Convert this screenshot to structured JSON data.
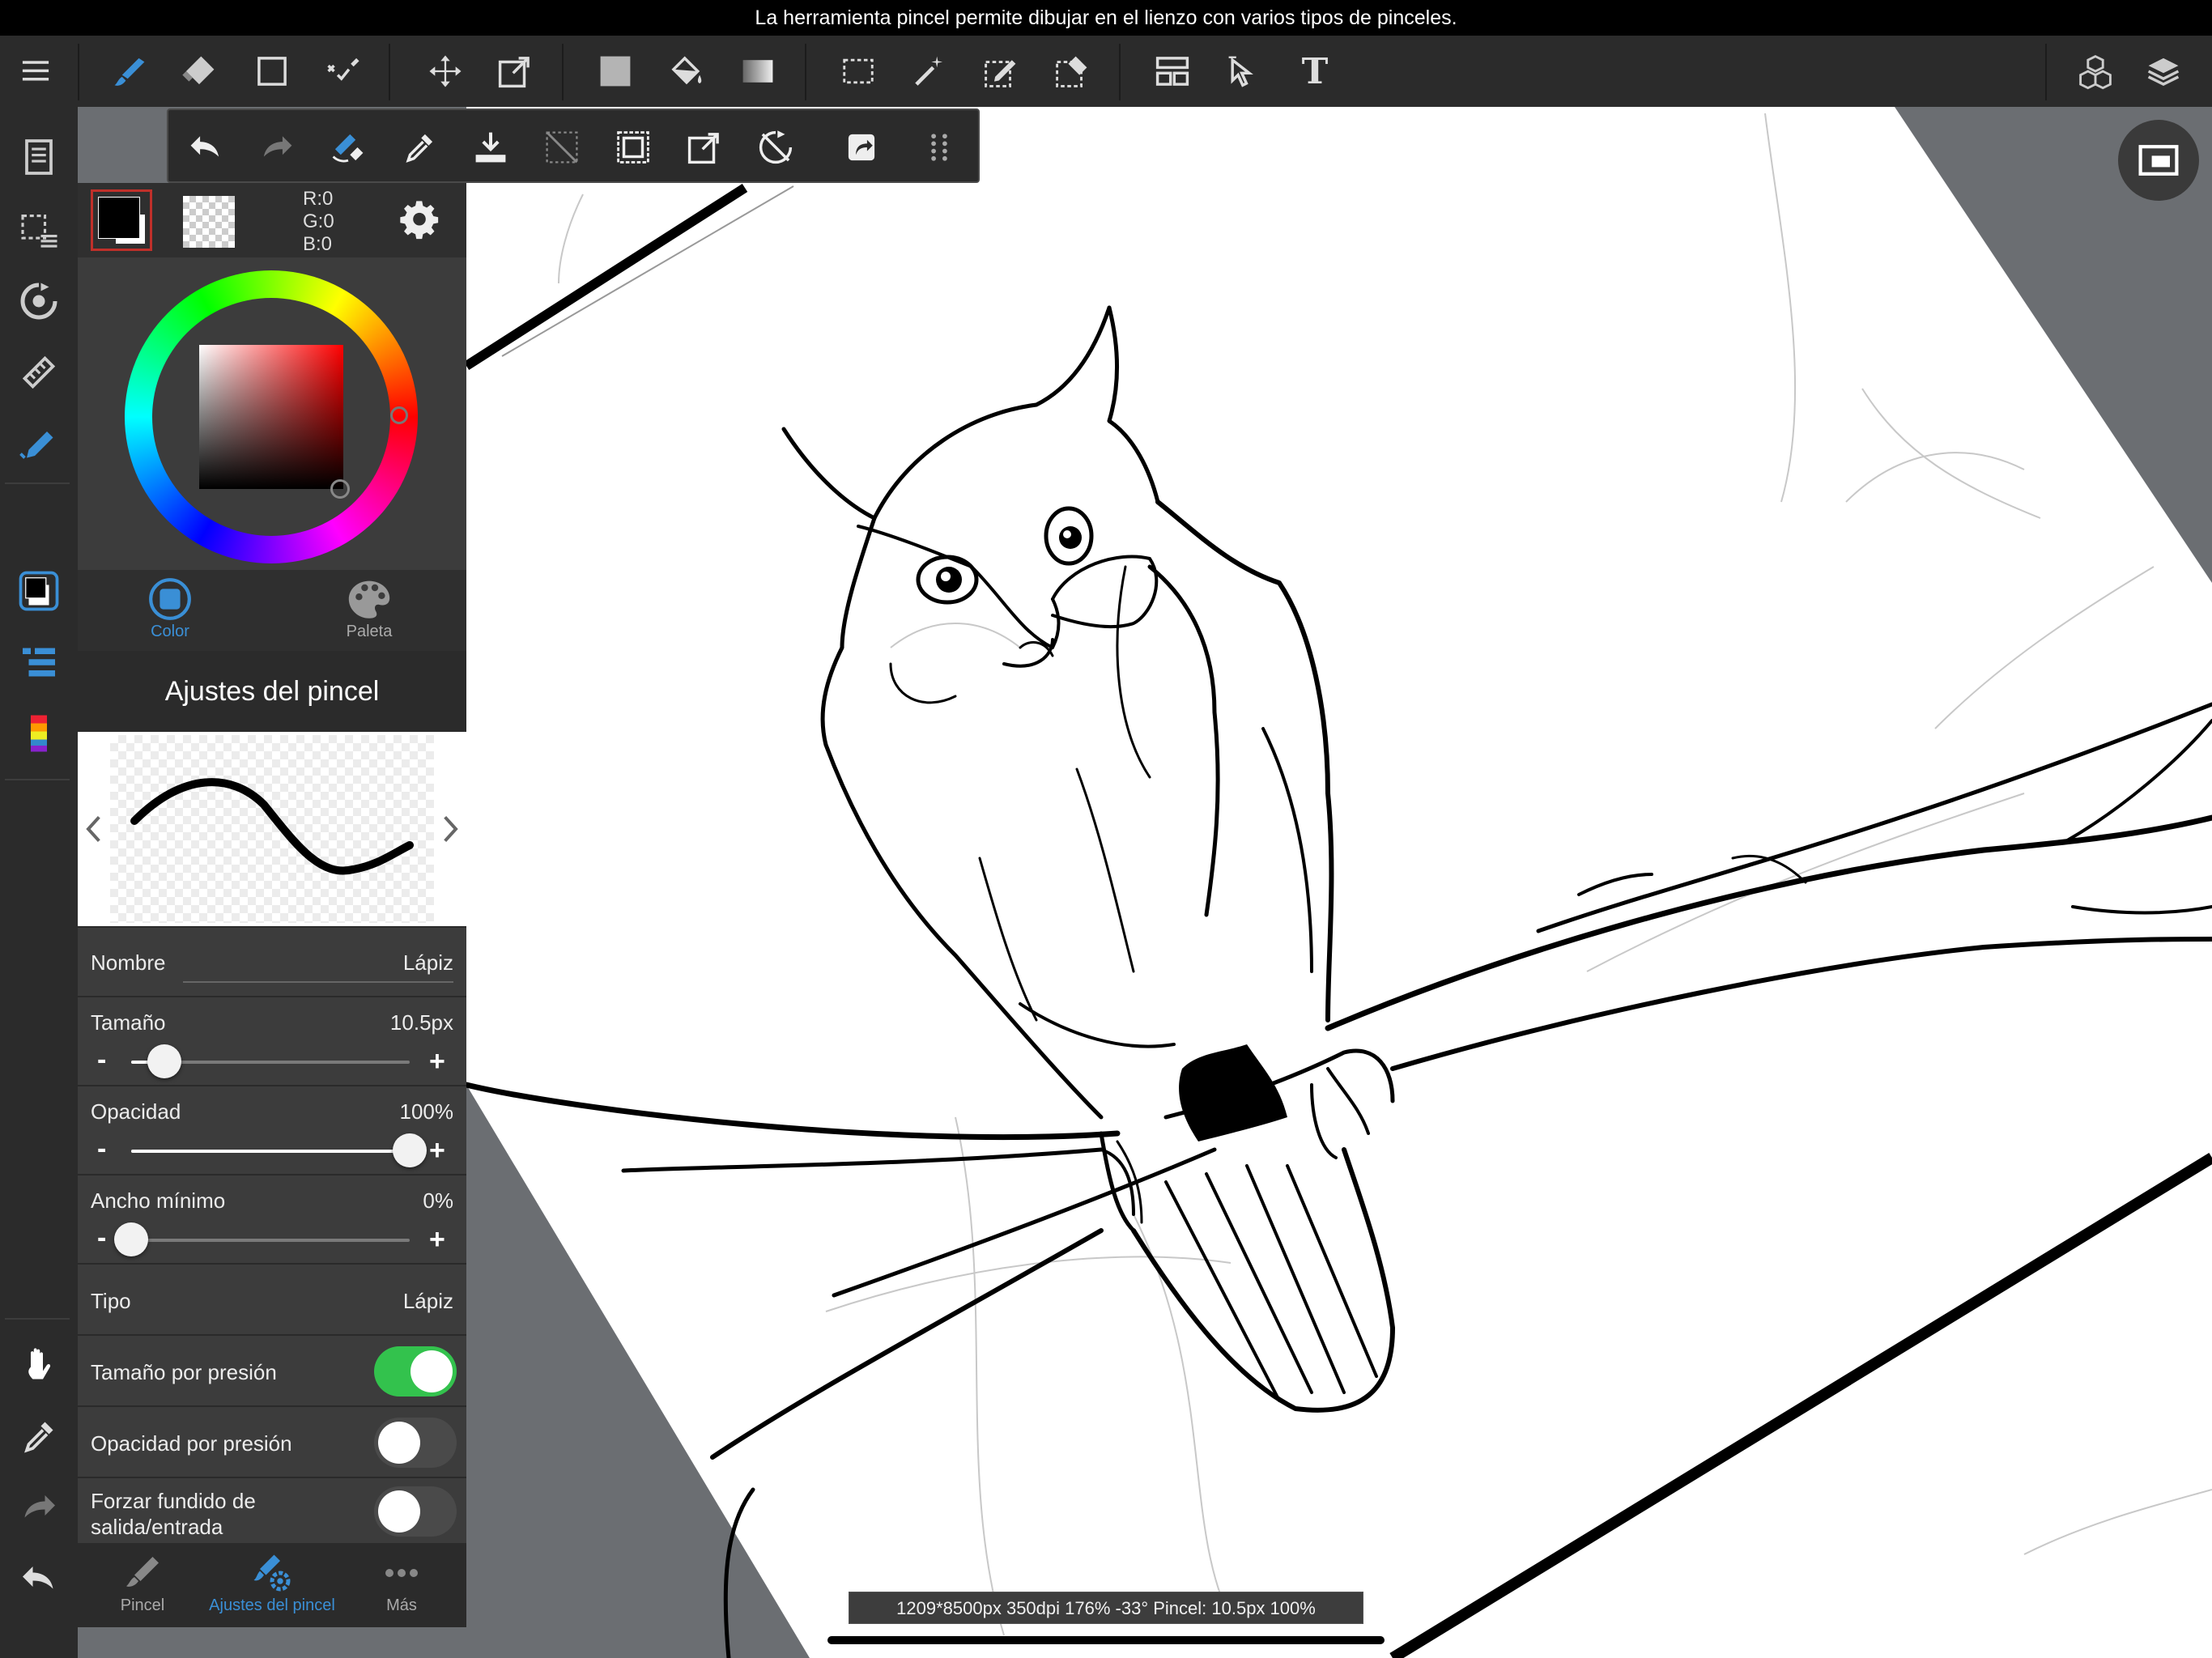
{
  "status_bar": {
    "message": "La herramienta pincel permite dibujar en el lienzo con varios tipos de pinceles."
  },
  "toolbar": {
    "tools": [
      {
        "name": "menu-icon"
      },
      {
        "name": "brush-icon"
      },
      {
        "name": "eraser-icon"
      },
      {
        "name": "shape-icon"
      },
      {
        "name": "stroke-correction-icon"
      },
      {
        "name": "move-icon"
      },
      {
        "name": "transform-icon"
      },
      {
        "name": "fill-color-icon"
      },
      {
        "name": "bucket-icon"
      },
      {
        "name": "gradient-icon"
      },
      {
        "name": "select-icon"
      },
      {
        "name": "magic-wand-icon"
      },
      {
        "name": "select-pen-icon"
      },
      {
        "name": "select-eraser-icon"
      },
      {
        "name": "frame-divider-icon"
      },
      {
        "name": "operation-icon"
      },
      {
        "name": "text-icon"
      },
      {
        "name": "material-icon"
      },
      {
        "name": "layers-icon"
      }
    ],
    "text_tool_label": "T",
    "accent_color": "#3a8fd6"
  },
  "color_panel": {
    "rgb": {
      "r": "R:0",
      "g": "G:0",
      "b": "B:0"
    },
    "tabs": [
      {
        "label": "Color"
      },
      {
        "label": "Paleta"
      }
    ],
    "foreground": "#000000"
  },
  "brush_settings": {
    "title": "Ajustes del pincel",
    "name_label": "Nombre",
    "name_value": "Lápiz",
    "size_label": "Tamaño",
    "size_value": "10.5px",
    "size_fraction": 0.12,
    "opacity_label": "Opacidad",
    "opacity_value": "100%",
    "opacity_fraction": 1.0,
    "min_width_label": "Ancho mínimo",
    "min_width_value": "0%",
    "min_width_fraction": 0.0,
    "type_label": "Tipo",
    "type_value": "Lápiz",
    "pressure_size_label": "Tamaño por presión",
    "pressure_size_on": true,
    "pressure_opacity_label": "Opacidad por presión",
    "pressure_opacity_on": false,
    "fade_label": "Forzar fundido de salida/entrada",
    "fade_on": false,
    "minus": "-",
    "plus": "+"
  },
  "bottom_tabs": [
    {
      "label": "Pincel"
    },
    {
      "label": "Ajustes del pincel"
    },
    {
      "label": "Más"
    }
  ],
  "info_bar": {
    "text": "1209*8500px 350dpi 176% -33° Pincel: 10.5px 100%"
  }
}
